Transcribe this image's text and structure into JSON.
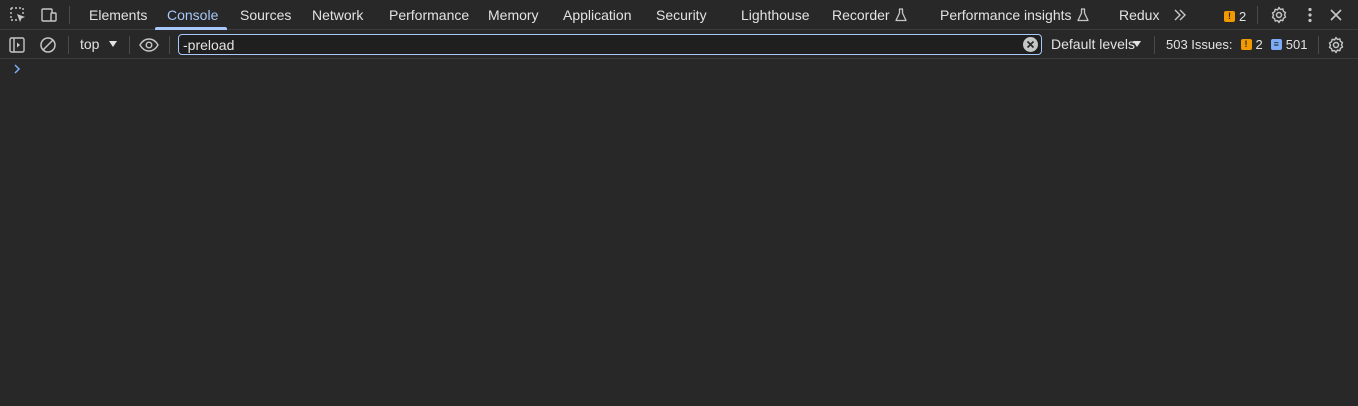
{
  "tabbar": {
    "tabs": [
      {
        "label": "Elements",
        "active": false
      },
      {
        "label": "Console",
        "active": true
      },
      {
        "label": "Sources",
        "active": false
      },
      {
        "label": "Network",
        "active": false
      },
      {
        "label": "Performance",
        "active": false
      },
      {
        "label": "Memory",
        "active": false
      },
      {
        "label": "Application",
        "active": false
      },
      {
        "label": "Security",
        "active": false
      },
      {
        "label": "Lighthouse",
        "active": false
      },
      {
        "label": "Recorder",
        "active": false,
        "experimental": true
      },
      {
        "label": "Performance insights",
        "active": false,
        "experimental": true
      },
      {
        "label": "Redux",
        "active": false
      }
    ],
    "warning_count": "2",
    "icons": {
      "inspect": "inspect-element-icon",
      "device": "device-toolbar-icon",
      "more_tabs": "chevron-double-right-icon",
      "settings": "gear-icon",
      "menu": "kebab-menu-icon",
      "close": "close-icon",
      "flask": "flask-icon"
    }
  },
  "toolbar": {
    "context": "top",
    "filter_value": "-preload",
    "levels_label": "Default levels",
    "issues_label": "503 Issues:",
    "issues_warning_count": "2",
    "issues_info_count": "501",
    "icons": {
      "sidebar": "sidebar-toggle-icon",
      "clear": "clear-console-icon",
      "eye": "eye-icon",
      "settings": "gear-icon",
      "clear_filter": "clear-circle-icon"
    }
  },
  "colors": {
    "background": "#282828",
    "accent": "#a8c7fa",
    "text": "#e3e3e3",
    "warning": "#f29900",
    "info": "#7cacf8"
  }
}
